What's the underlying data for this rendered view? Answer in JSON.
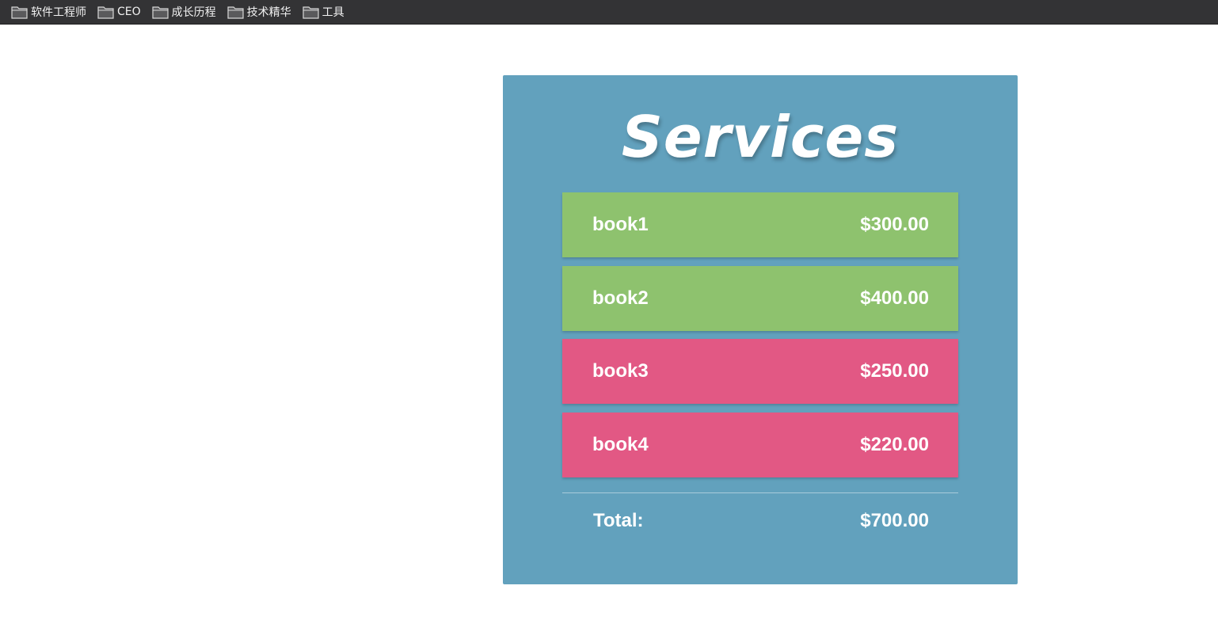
{
  "bookmarks": [
    {
      "label": "软件工程师",
      "icon": "folder-icon"
    },
    {
      "label": "CEO",
      "icon": "folder-icon"
    },
    {
      "label": "成长历程",
      "icon": "folder-icon"
    },
    {
      "label": "技术精华",
      "icon": "folder-icon"
    },
    {
      "label": "工具",
      "icon": "folder-icon"
    }
  ],
  "services": {
    "title": "Services",
    "items": [
      {
        "name": "book1",
        "price": "$300.00",
        "state": "selected",
        "color": "#8ec26e"
      },
      {
        "name": "book2",
        "price": "$400.00",
        "state": "selected",
        "color": "#8ec26e"
      },
      {
        "name": "book3",
        "price": "$250.00",
        "state": "unselected",
        "color": "#e25884"
      },
      {
        "name": "book4",
        "price": "$220.00",
        "state": "unselected",
        "color": "#e25884"
      }
    ],
    "total_label": "Total:",
    "total_value": "$700.00"
  },
  "colors": {
    "card_background": "#62a1bd",
    "selected": "#8ec26e",
    "unselected": "#e25884",
    "bookmarks_bar": "#333335"
  }
}
